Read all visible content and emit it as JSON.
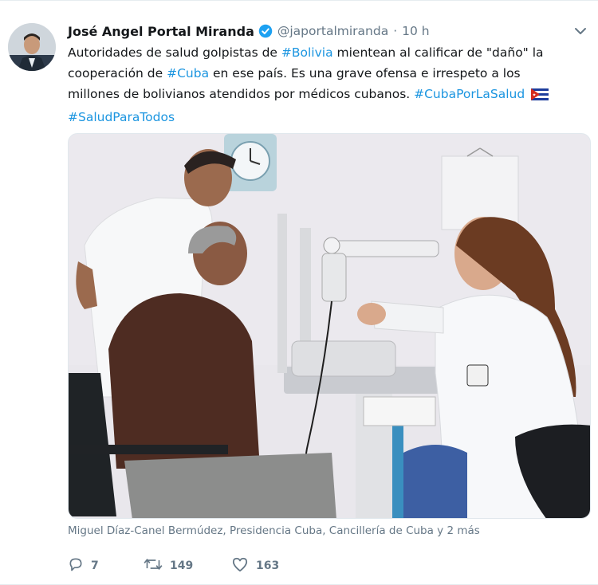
{
  "tweet": {
    "author_name": "José Angel Portal Miranda",
    "handle": "@japortalmiranda",
    "separator": "·",
    "time": "10 h",
    "text": {
      "l1_a": "Autoridades de salud golpistas de ",
      "l1_tag": "#Bolivia",
      "l1_b": " mientean al calificar de \"daño\" la",
      "l2_a": "cooperación de ",
      "l2_tag": "#Cuba",
      "l2_b": " en ese país. Es una grave ofensa e irrespeto a los",
      "l3_a": "millones de bolivianos atendidos por médicos cubanos.  ",
      "l3_tag": "#CubaPorLaSalud",
      "l4_tag": "#SaludParaTodos"
    },
    "photo_tags": "Miguel Díaz-Canel Bermúdez, Presidencia Cuba, Cancillería de Cuba y 2 más",
    "reply_count": "7",
    "retweet_count": "149",
    "like_count": "163"
  },
  "colors": {
    "link": "#1b95e0",
    "muted": "#657786",
    "verified": "#1da1f2"
  },
  "icons": [
    "verified-badge-icon",
    "chevron-down-icon",
    "cuba-flag-icon",
    "reply-icon",
    "retweet-icon",
    "like-icon"
  ]
}
